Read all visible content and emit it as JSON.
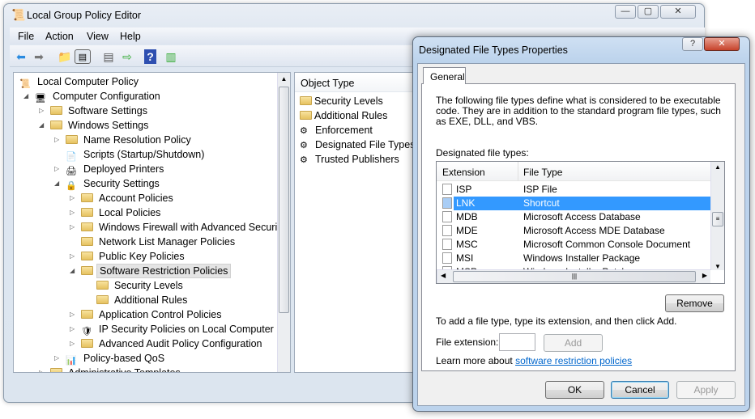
{
  "window": {
    "title": "Local Group Policy Editor",
    "minimize": "—",
    "maximize": "▢",
    "close": "✕"
  },
  "menu": [
    "File",
    "Action",
    "View",
    "Help"
  ],
  "toolbar": [
    "back-icon",
    "forward-icon",
    "up-folder-icon",
    "show-hide-tree-icon",
    "properties-icon",
    "export-list-icon",
    "help-icon",
    "show-action-pane-icon"
  ],
  "tree": [
    {
      "label": "Local Computer Policy",
      "depth": 0,
      "exp": "none",
      "icon": "policy"
    },
    {
      "label": "Computer Configuration",
      "depth": 1,
      "exp": "open",
      "icon": "computer"
    },
    {
      "label": "Software Settings",
      "depth": 2,
      "exp": "closed",
      "icon": "folder"
    },
    {
      "label": "Windows Settings",
      "depth": 2,
      "exp": "open",
      "icon": "folder"
    },
    {
      "label": "Name Resolution Policy",
      "depth": 3,
      "exp": "closed",
      "icon": "folder"
    },
    {
      "label": "Scripts (Startup/Shutdown)",
      "depth": 3,
      "exp": "none",
      "icon": "script"
    },
    {
      "label": "Deployed Printers",
      "depth": 3,
      "exp": "closed",
      "icon": "printer"
    },
    {
      "label": "Security Settings",
      "depth": 3,
      "exp": "open",
      "icon": "security"
    },
    {
      "label": "Account Policies",
      "depth": 4,
      "exp": "closed",
      "icon": "folder"
    },
    {
      "label": "Local Policies",
      "depth": 4,
      "exp": "closed",
      "icon": "folder"
    },
    {
      "label": "Windows Firewall with Advanced Security",
      "depth": 4,
      "exp": "closed",
      "icon": "folder"
    },
    {
      "label": "Network List Manager Policies",
      "depth": 4,
      "exp": "none",
      "icon": "folder"
    },
    {
      "label": "Public Key Policies",
      "depth": 4,
      "exp": "closed",
      "icon": "folder"
    },
    {
      "label": "Software Restriction Policies",
      "depth": 4,
      "exp": "open",
      "icon": "folder",
      "selected": true
    },
    {
      "label": "Security Levels",
      "depth": 5,
      "exp": "none",
      "icon": "folder"
    },
    {
      "label": "Additional Rules",
      "depth": 5,
      "exp": "none",
      "icon": "folder"
    },
    {
      "label": "Application Control Policies",
      "depth": 4,
      "exp": "closed",
      "icon": "folder"
    },
    {
      "label": "IP Security Policies on Local Computer",
      "depth": 4,
      "exp": "closed",
      "icon": "ipsec"
    },
    {
      "label": "Advanced Audit Policy Configuration",
      "depth": 4,
      "exp": "closed",
      "icon": "folder"
    },
    {
      "label": "Policy-based QoS",
      "depth": 3,
      "exp": "closed",
      "icon": "chart"
    },
    {
      "label": "Administrative Templates",
      "depth": 2,
      "exp": "closed",
      "icon": "folder"
    }
  ],
  "list": {
    "header": "Object Type",
    "items": [
      {
        "label": "Security Levels",
        "icon": "folder"
      },
      {
        "label": "Additional Rules",
        "icon": "folder"
      },
      {
        "label": "Enforcement",
        "icon": "setting"
      },
      {
        "label": "Designated File Types",
        "icon": "setting"
      },
      {
        "label": "Trusted Publishers",
        "icon": "setting"
      }
    ]
  },
  "dialog": {
    "title": "Designated File Types Properties",
    "help": "?",
    "close": "✕",
    "tab": "General",
    "description": "The following file types define what is considered to be executable code. They are in addition to the standard program file types, such as EXE, DLL, and VBS.",
    "list_label": "Designated file types:",
    "columns": [
      "Extension",
      "File Type"
    ],
    "rows": [
      {
        "ext": "ISP",
        "type": "ISP File"
      },
      {
        "ext": "LNK",
        "type": "Shortcut",
        "selected": true
      },
      {
        "ext": "MDB",
        "type": "Microsoft Access Database"
      },
      {
        "ext": "MDE",
        "type": "Microsoft Access MDE Database"
      },
      {
        "ext": "MSC",
        "type": "Microsoft Common Console Document"
      },
      {
        "ext": "MSI",
        "type": "Windows Installer Package"
      },
      {
        "ext": "MSP",
        "type": "Windows Installer Patch"
      }
    ],
    "remove": "Remove",
    "add_hint": "To add a file type, type its extension, and then click Add.",
    "ext_label": "File extension:",
    "ext_value": "",
    "add": "Add",
    "learn_prefix": "Learn more about ",
    "learn_link": "software restriction policies",
    "ok": "OK",
    "cancel": "Cancel",
    "apply": "Apply"
  },
  "colors": {
    "selection": "#3399ff",
    "link": "#0066cc",
    "tree_selected": "#e4e4e4"
  }
}
